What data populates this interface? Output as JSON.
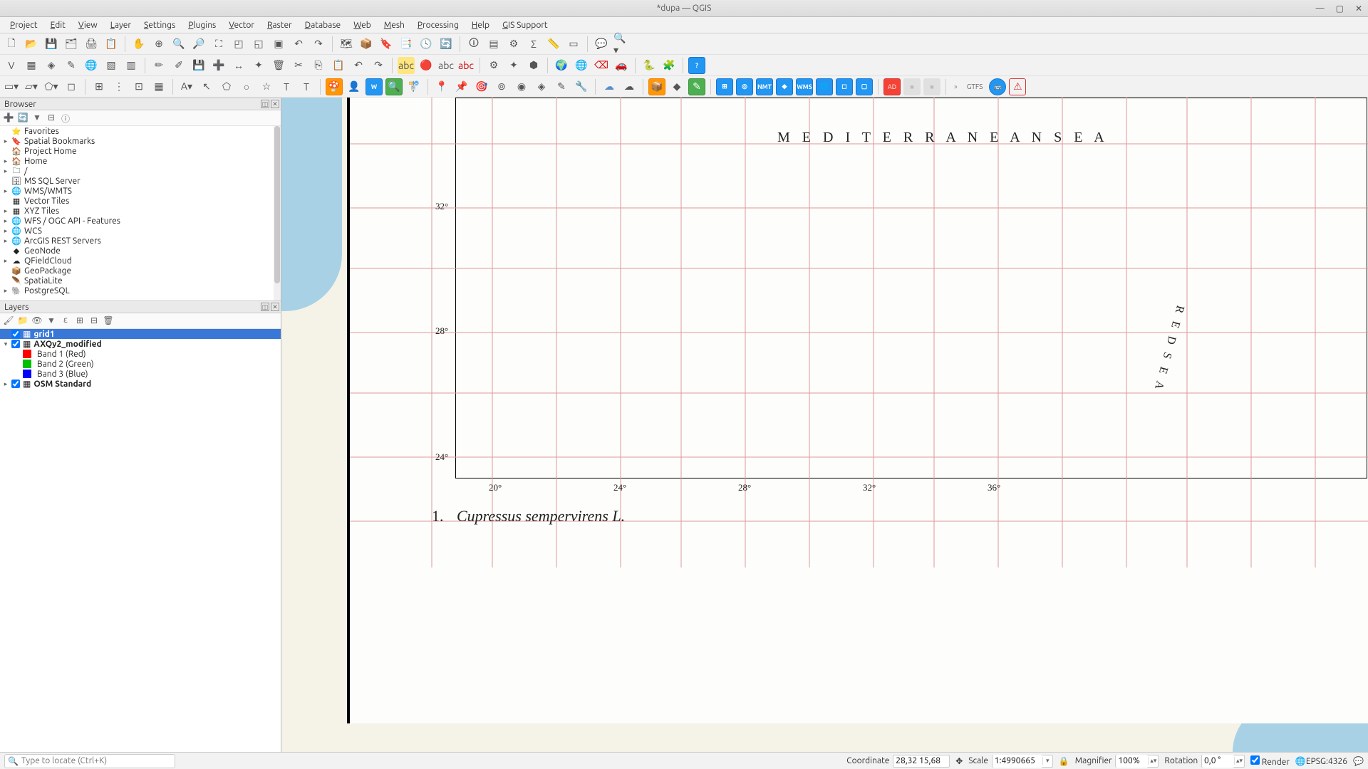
{
  "title": "*dupa — QGIS",
  "menus": [
    "Project",
    "Edit",
    "View",
    "Layer",
    "Settings",
    "Plugins",
    "Vector",
    "Raster",
    "Database",
    "Web",
    "Mesh",
    "Processing",
    "Help",
    "GIS Support"
  ],
  "browser": {
    "title": "Browser",
    "items": [
      {
        "icon": "⭐",
        "label": "Favorites",
        "exp": ""
      },
      {
        "icon": "🔖",
        "label": "Spatial Bookmarks",
        "exp": "▸"
      },
      {
        "icon": "🏠",
        "label": "Project Home",
        "exp": ""
      },
      {
        "icon": "🏠",
        "label": "Home",
        "exp": "▸"
      },
      {
        "icon": "🗀",
        "label": "/",
        "exp": "▸"
      },
      {
        "icon": "🗄",
        "label": "MS SQL Server",
        "exp": ""
      },
      {
        "icon": "🌐",
        "label": "WMS/WMTS",
        "exp": "▸"
      },
      {
        "icon": "▦",
        "label": "Vector Tiles",
        "exp": ""
      },
      {
        "icon": "▦",
        "label": "XYZ Tiles",
        "exp": "▸"
      },
      {
        "icon": "🌐",
        "label": "WFS / OGC API - Features",
        "exp": "▸"
      },
      {
        "icon": "🌐",
        "label": "WCS",
        "exp": "▸"
      },
      {
        "icon": "🌐",
        "label": "ArcGIS REST Servers",
        "exp": "▸"
      },
      {
        "icon": "◆",
        "label": "GeoNode",
        "exp": ""
      },
      {
        "icon": "☁",
        "label": "QFieldCloud",
        "exp": "▸"
      },
      {
        "icon": "📦",
        "label": "GeoPackage",
        "exp": ""
      },
      {
        "icon": "🪶",
        "label": "SpatiaLite",
        "exp": ""
      },
      {
        "icon": "🐘",
        "label": "PostgreSQL",
        "exp": "▸"
      }
    ]
  },
  "layers": {
    "title": "Layers",
    "rows": [
      {
        "type": "layer",
        "checked": true,
        "selected": true,
        "exp": "",
        "icon": "▦",
        "label": "grid1",
        "bold": true
      },
      {
        "type": "layer",
        "checked": true,
        "selected": false,
        "exp": "▾",
        "icon": "▦",
        "label": "AXQy2_modified",
        "bold": true
      },
      {
        "type": "band",
        "color": "#ff0000",
        "label": "Band 1 (Red)"
      },
      {
        "type": "band",
        "color": "#00c000",
        "label": "Band 2 (Green)"
      },
      {
        "type": "band",
        "color": "#0000ff",
        "label": "Band 3 (Blue)"
      },
      {
        "type": "layer",
        "checked": true,
        "selected": false,
        "exp": "▸",
        "icon": "▦",
        "label": "OSM Standard",
        "bold": true
      }
    ]
  },
  "map_labels": {
    "title_sea": "M E D I T E R R A N E A N   S E A",
    "red_sea": "R E D   S E A",
    "lat1": "32°",
    "lat2": "28°",
    "lat3": "24°",
    "lon1": "20°",
    "lon2": "24°",
    "lon3": "28°",
    "lon4": "32°",
    "lon5": "36°",
    "caption_no": "1.",
    "caption": "Cupressus sempervirens L."
  },
  "statusbar": {
    "locator_placeholder": "Type to locate (Ctrl+K)",
    "coordinate_label": "Coordinate",
    "coordinate": "28,32 15,68",
    "scale_label": "Scale",
    "scale": "1:4990665",
    "magnifier_label": "Magnifier",
    "magnifier": "100%",
    "rotation_label": "Rotation",
    "rotation": "0,0 °",
    "render_label": "Render",
    "crs": "EPSG:4326"
  },
  "badges": {
    "nmt": "NMT",
    "wms": "WMS",
    "ad": "AD",
    "gtfs": "GTFS"
  }
}
